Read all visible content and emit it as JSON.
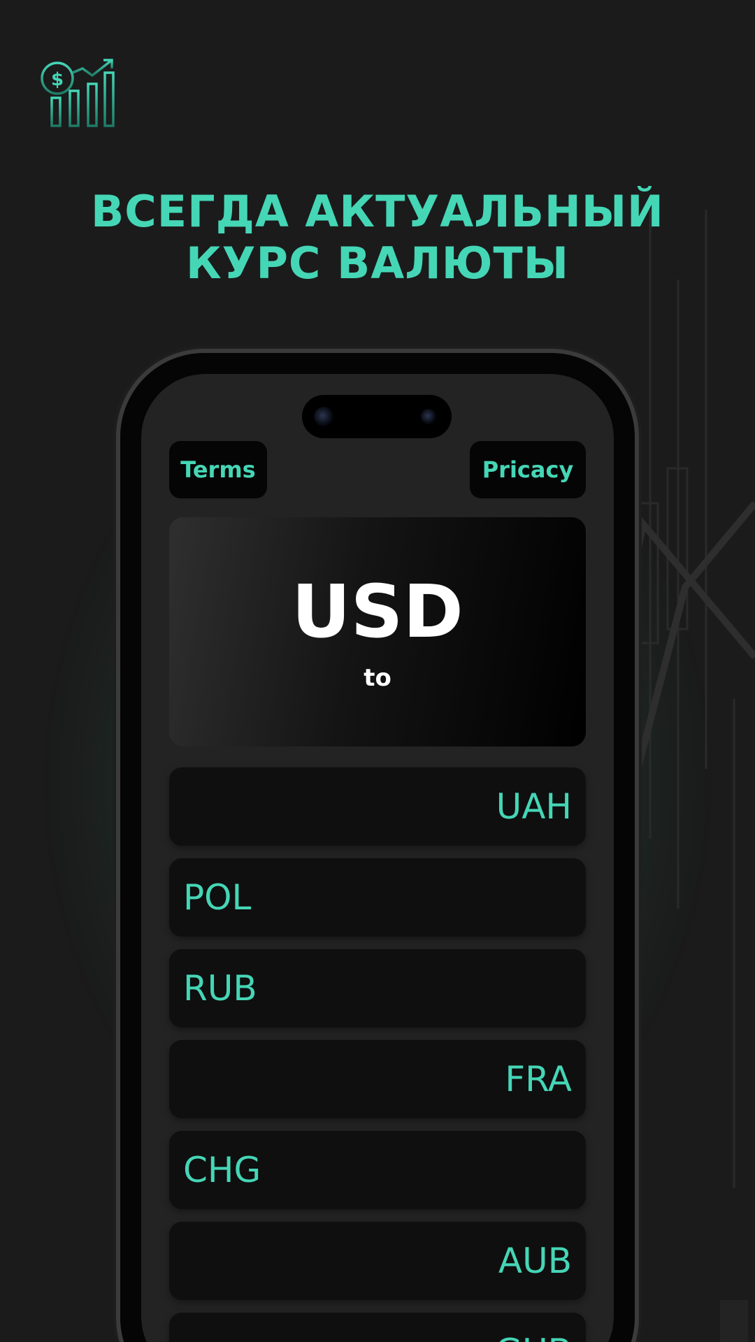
{
  "headline": {
    "line1": "ВСЕГДА АКТУАЛЬНЫЙ",
    "line2": "КУРС ВАЛЮТЫ"
  },
  "colors": {
    "accent": "#45d6b6",
    "background": "#1b1b1b"
  },
  "logo": {
    "icon": "dollar-growth-chart-icon"
  },
  "app": {
    "terms_label": "Terms",
    "privacy_label": "Pricacy",
    "base_currency": "USD",
    "base_sub": "to",
    "currencies": [
      {
        "code": "UAH",
        "align": "right"
      },
      {
        "code": "POL",
        "align": "left"
      },
      {
        "code": "RUB",
        "align": "left"
      },
      {
        "code": "FRA",
        "align": "right"
      },
      {
        "code": "CHG",
        "align": "left"
      },
      {
        "code": "AUB",
        "align": "right"
      },
      {
        "code": "GUB",
        "align": "right"
      }
    ]
  }
}
